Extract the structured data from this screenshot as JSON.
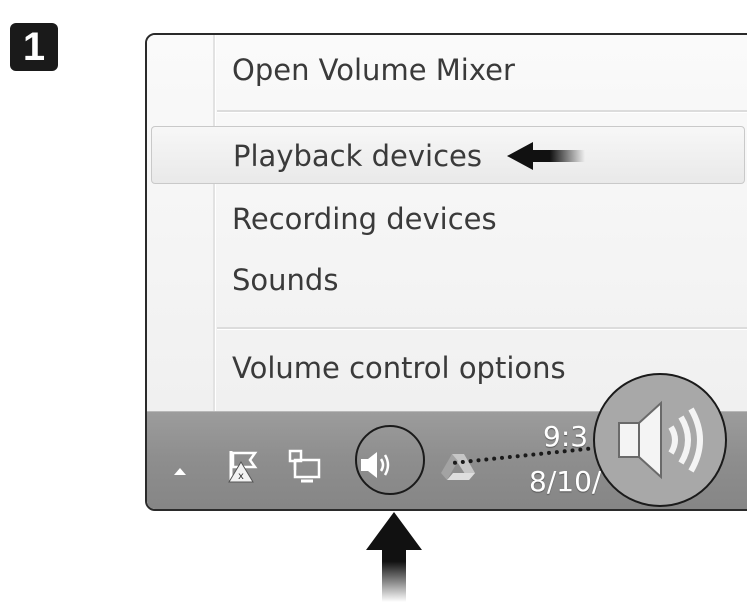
{
  "step": {
    "number": "1"
  },
  "menu": {
    "items": [
      {
        "label": "Open Volume Mixer"
      },
      {
        "label": "Playback devices"
      },
      {
        "label": "Recording devices"
      },
      {
        "label": "Sounds"
      },
      {
        "label": "Volume control options"
      }
    ]
  },
  "taskbar": {
    "icons": [
      "show-hidden-icons-arrow",
      "action-center-flag-icon",
      "network-icon",
      "volume-icon",
      "google-drive-icon"
    ],
    "clock_time": "9:3",
    "clock_date": "8/10/"
  },
  "annotations": {
    "highlight_color": "#1a1a1a"
  }
}
